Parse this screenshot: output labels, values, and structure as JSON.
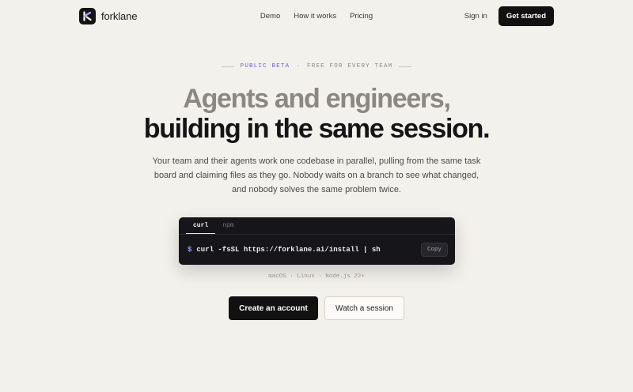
{
  "brand": {
    "name": "forklane",
    "logo_icon": "fork-arrow-logo-icon"
  },
  "nav": {
    "items": [
      "Demo",
      "How it works",
      "Pricing"
    ]
  },
  "header": {
    "signin_label": "Sign in",
    "cta_label": "Get started"
  },
  "hero": {
    "badge": {
      "accent": "PUBLIC BETA",
      "separator": "·",
      "rest": "FREE FOR EVERY TEAM"
    },
    "headline_line1": "Agents and engineers,",
    "headline_line2": "building in the same session.",
    "subtitle_lines": [
      "Your team and their agents work one codebase in parallel, pulling from the same task",
      "board and claiming files as they go. Nobody waits on a branch to see what changed,",
      "and nobody solves the same problem twice."
    ]
  },
  "terminal": {
    "tabs": [
      {
        "label": "curl",
        "active": true
      },
      {
        "label": "npm",
        "active": false
      }
    ],
    "prompt": "$",
    "command": "curl -fsSL https://forklane.ai/install | sh",
    "copy_label": "Copy"
  },
  "platforms": "macOS · Linux · Node.js 22+",
  "ctas": {
    "primary": "Create an account",
    "secondary": "Watch a session"
  },
  "colors": {
    "background": "#f3f1ec",
    "accent": "#6b5fd1",
    "dark": "#111111",
    "terminal_bg": "#15151a"
  }
}
